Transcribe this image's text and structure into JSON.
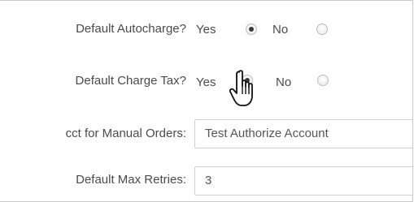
{
  "form": {
    "autocharge": {
      "label": "Default Autocharge?",
      "yes": "Yes",
      "no": "No",
      "selected": "yes"
    },
    "charge_tax": {
      "label": "Default Charge Tax?",
      "yes": "Yes",
      "no": "No",
      "selected": "yes"
    },
    "manual_orders": {
      "label": "cct for Manual Orders:",
      "value": "Test Authorize Account"
    },
    "max_retries": {
      "label": "Default Max Retries:",
      "value": "3"
    }
  },
  "cursor": {
    "icon": "hand-pointer-icon"
  }
}
